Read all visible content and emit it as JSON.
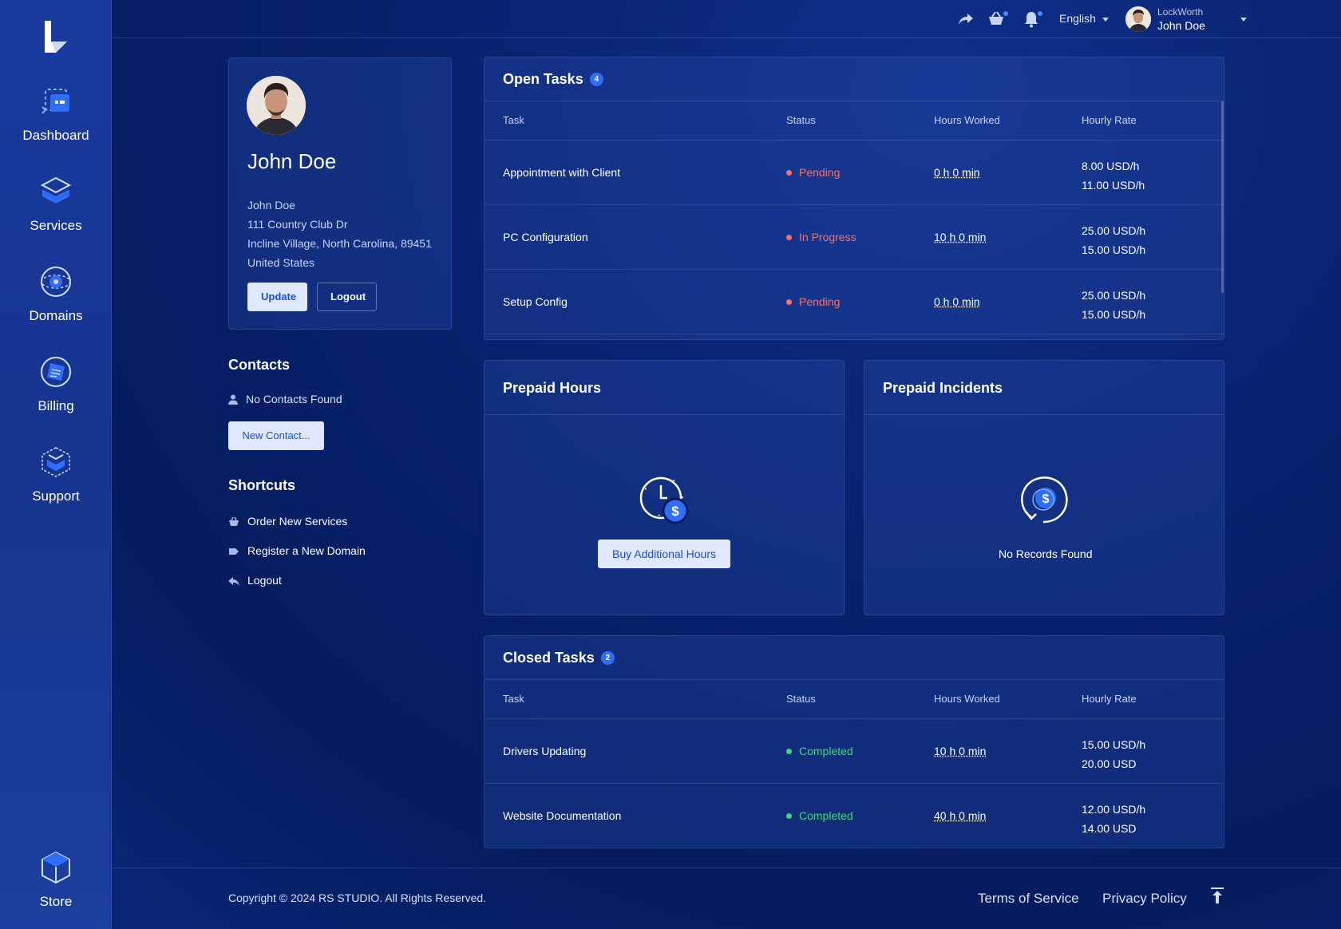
{
  "sidebar": {
    "items": [
      {
        "label": "Dashboard",
        "icon": "dashboard-icon"
      },
      {
        "label": "Services",
        "icon": "services-icon"
      },
      {
        "label": "Domains",
        "icon": "domains-icon"
      },
      {
        "label": "Billing",
        "icon": "billing-icon"
      },
      {
        "label": "Support",
        "icon": "support-icon"
      }
    ],
    "store": {
      "label": "Store",
      "icon": "store-icon"
    }
  },
  "topbar": {
    "language": "English",
    "user_company": "LockWorth",
    "user_name": "John Doe"
  },
  "profile": {
    "display_name": "John Doe",
    "address_lines": [
      "John Doe",
      "111 Country Club Dr",
      "Incline Village, North Carolina, 89451",
      "United States"
    ],
    "update_label": "Update",
    "logout_label": "Logout"
  },
  "contacts": {
    "title": "Contacts",
    "empty_text": "No Contacts Found",
    "new_contact_label": "New Contact..."
  },
  "shortcuts": {
    "title": "Shortcuts",
    "items": [
      {
        "label": "Order New Services",
        "icon": "basket-icon"
      },
      {
        "label": "Register a New Domain",
        "icon": "tag-icon"
      },
      {
        "label": "Logout",
        "icon": "reply-icon"
      }
    ]
  },
  "open_tasks": {
    "title": "Open Tasks",
    "count": "4",
    "columns": [
      "Task",
      "Status",
      "Hours Worked",
      "Hourly Rate"
    ],
    "rows": [
      {
        "task": "Appointment with Client",
        "status": "Pending",
        "hours": "0 h 0 min",
        "rate1": "8.00 USD/h",
        "rate2": "11.00 USD/h"
      },
      {
        "task": "PC Configuration",
        "status": "In Progress",
        "hours": "10 h 0 min",
        "rate1": "25.00 USD/h",
        "rate2": "15.00 USD/h"
      },
      {
        "task": "Setup Config",
        "status": "Pending",
        "hours": "0 h 0 min",
        "rate1": "25.00 USD/h",
        "rate2": "15.00 USD/h"
      }
    ]
  },
  "prepaid_hours": {
    "title": "Prepaid Hours",
    "button_label": "Buy Additional Hours"
  },
  "prepaid_incidents": {
    "title": "Prepaid Incidents",
    "empty_text": "No Records Found"
  },
  "closed_tasks": {
    "title": "Closed Tasks",
    "count": "2",
    "columns": [
      "Task",
      "Status",
      "Hours Worked",
      "Hourly Rate"
    ],
    "rows": [
      {
        "task": "Drivers Updating",
        "status": "Completed",
        "hours": "10 h 0 min",
        "rate1": "15.00 USD/h",
        "rate2": "20.00 USD"
      },
      {
        "task": "Website Documentation",
        "status": "Completed",
        "hours": "40 h 0 min",
        "rate1": "12.00 USD/h",
        "rate2": "14.00 USD"
      }
    ]
  },
  "footer": {
    "copyright": "Copyright © 2024 RS STUDIO. All Rights Reserved.",
    "terms": "Terms of Service",
    "privacy": "Privacy Policy"
  },
  "colors": {
    "accent": "#2f6dfa",
    "pending": "#f2726f",
    "completed": "#3fd67e",
    "background": "#082370"
  }
}
